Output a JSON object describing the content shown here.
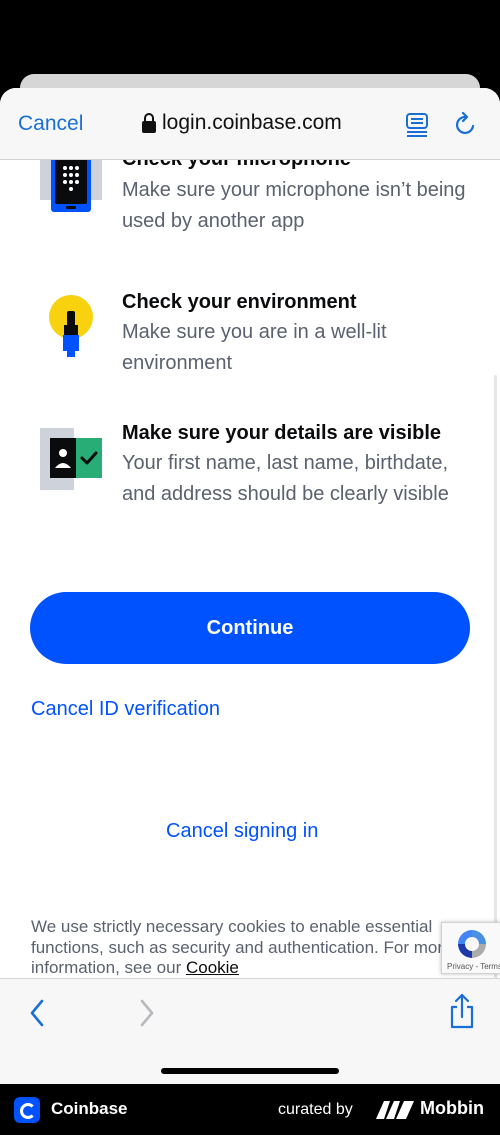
{
  "browser": {
    "cancel_label": "Cancel",
    "url": "login.coinbase.com"
  },
  "checks": [
    {
      "title": "Check your microphone",
      "description": "Make sure your microphone isn’t being used by another app"
    },
    {
      "title": "Check your environment",
      "description": "Make sure you are in a well-lit environment"
    },
    {
      "title": "Make sure your details are visible",
      "description": "Your first name, last name, birthdate, and address should be clearly visible"
    }
  ],
  "actions": {
    "continue_label": "Continue",
    "cancel_id_label": "Cancel ID verification",
    "cancel_signin_label": "Cancel signing in"
  },
  "cookie": {
    "text": "We use strictly necessary cookies to enable essential functions, such as security and authentication. For more information, see our ",
    "link": "Cookie"
  },
  "recaptcha": {
    "links": "Privacy - Terms"
  },
  "footer": {
    "app_name": "Coinbase",
    "curated_by": "curated by",
    "brand": "Mobbin"
  },
  "colors": {
    "accent": "#0052ff",
    "ios_link": "#1a6fd6",
    "icon_yellow": "#f8d20f",
    "icon_green": "#27ad75",
    "icon_gray": "#ced2db"
  }
}
